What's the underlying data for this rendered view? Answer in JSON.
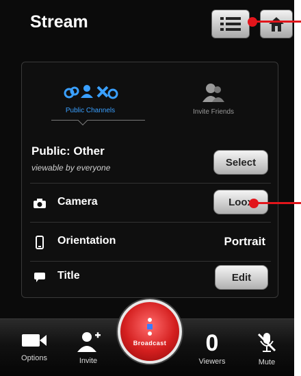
{
  "header": {
    "title": "Stream"
  },
  "tabs": [
    {
      "label": "Public Channels",
      "active": true
    },
    {
      "label": "Invite Friends",
      "active": false
    }
  ],
  "settings": {
    "public": {
      "title": "Public: Other",
      "subtitle": "viewable by everyone",
      "button": "Select"
    },
    "camera": {
      "label": "Camera",
      "button": "Loox"
    },
    "orientation": {
      "label": "Orientation",
      "value": "Portrait"
    },
    "title": {
      "label": "Title",
      "button": "Edit"
    }
  },
  "bottom_bar": {
    "options": "Options",
    "invite": "Invite",
    "broadcast": "Broadcast",
    "viewers_count": "0",
    "viewers": "Viewers",
    "mute": "Mute"
  },
  "colors": {
    "accent_blue": "#3aa0ff",
    "broadcast_red": "#d41f1f",
    "annotation_red": "#e2151b"
  },
  "icons": [
    "list-icon",
    "home-icon",
    "public-channels-icon",
    "invite-friends-icon",
    "camera-icon",
    "phone-icon",
    "speech-bubble-icon",
    "video-camera-icon",
    "person-plus-icon",
    "microphone-mute-icon"
  ]
}
